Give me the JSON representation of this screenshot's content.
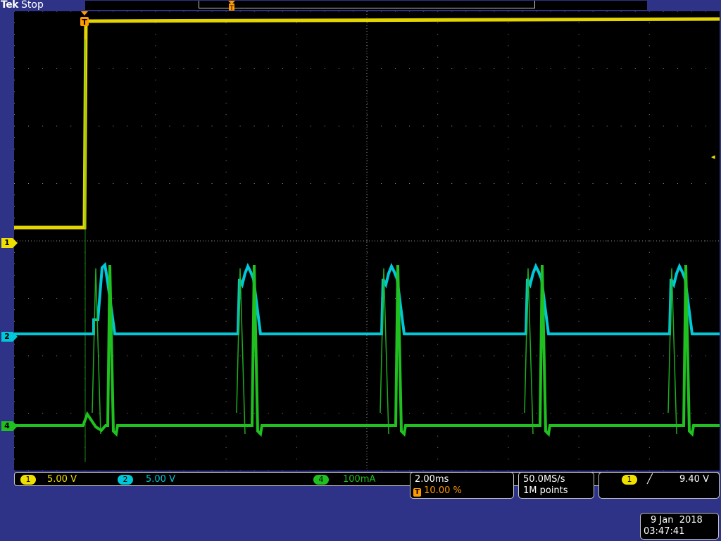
{
  "header": {
    "brand": "Tek",
    "state": "Stop"
  },
  "markers": {
    "ch1": "1",
    "ch2": "2",
    "ch4": "4",
    "trigger": "T"
  },
  "channels": [
    {
      "id": "1",
      "scale": "5.00 V",
      "color": "#f0e000"
    },
    {
      "id": "2",
      "scale": "5.00 V",
      "color": "#00c8d8"
    },
    {
      "id": "4",
      "scale": "100mA",
      "color": "#20c020"
    }
  ],
  "timebase": {
    "scale": "2.00ms",
    "trigger_position": "10.00 %"
  },
  "acquisition": {
    "sample_rate": "50.0MS/s",
    "record_length": "1M points"
  },
  "trigger": {
    "source": "1",
    "slope_icon": "rising-edge-icon",
    "slope_glyph": "╱",
    "level": "9.40 V"
  },
  "timestamp": {
    "date": "9 Jan  2018",
    "time": "03:47:41"
  },
  "colors": {
    "background": "#2e3387",
    "grid": "#8a8a8a",
    "ch1": "#f0e000",
    "ch2": "#00c8d8",
    "ch4": "#20c020",
    "trigger": "#ff9a00"
  }
}
